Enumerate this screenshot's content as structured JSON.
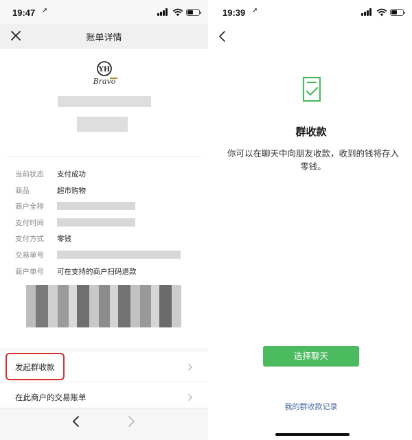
{
  "left": {
    "status": {
      "time": "19:47"
    },
    "nav": {
      "title": "账单详情"
    },
    "logo": {
      "monogram": "YH",
      "brand": "Bravo"
    },
    "info_rows": [
      {
        "label": "当前状态",
        "value": "支付成功",
        "blurred": false
      },
      {
        "label": "商品",
        "value": "超市购物",
        "blurred": false
      },
      {
        "label": "商户全称",
        "value": "",
        "blurred": true
      },
      {
        "label": "支付时间",
        "value": "",
        "blurred": true
      },
      {
        "label": "支付方式",
        "value": "零钱",
        "blurred": false
      },
      {
        "label": "交易单号",
        "value": "",
        "blurred": true
      },
      {
        "label": "商户单号",
        "value": "可在支持的商户扫码退款",
        "blurred": false
      }
    ],
    "menu": [
      {
        "label": "发起群收款"
      },
      {
        "label": "在此商户的交易账单"
      }
    ]
  },
  "right": {
    "status": {
      "time": "19:39"
    },
    "title": "群收款",
    "description": "你可以在聊天中向朋友收款，收到的钱将存入零钱。",
    "select_chat_button": "选择聊天",
    "records_link": "我的群收款记录"
  },
  "colors": {
    "accent_green": "#4cba5f",
    "highlight_red": "#d8322e",
    "link_blue": "#4a6aa0"
  },
  "icons": [
    "close-icon",
    "chevron-right-icon",
    "back-arrow-icon",
    "forward-arrow-icon",
    "document-check-icon",
    "signal-icon",
    "wifi-icon",
    "battery-icon",
    "location-arrow-icon"
  ]
}
